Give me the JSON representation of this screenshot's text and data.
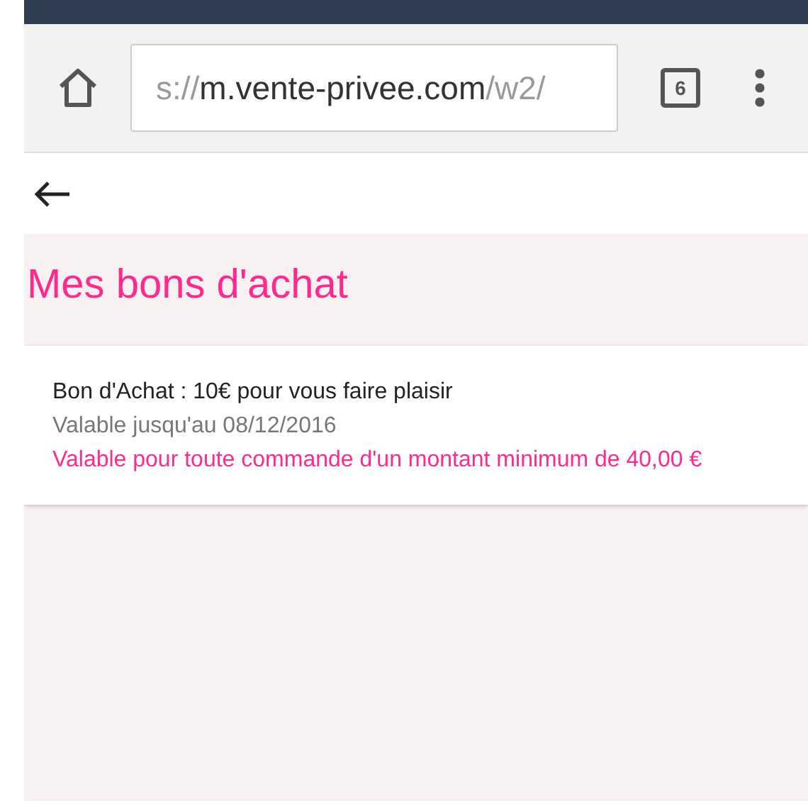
{
  "toolbar": {
    "url_parts": [
      {
        "text": "s://",
        "dim": true
      },
      {
        "text": "m.vente-privee.com",
        "dim": false
      },
      {
        "text": "/w2/",
        "dim": true
      }
    ],
    "tab_count": "6"
  },
  "page": {
    "title": "Mes bons d'achat",
    "vouchers": [
      {
        "name": "Bon d'Achat : 10€ pour vous faire plaisir",
        "validity": "Valable jusqu'au 08/12/2016",
        "condition": "Valable pour toute commande d'un montant minimum de 40,00 €"
      }
    ]
  }
}
